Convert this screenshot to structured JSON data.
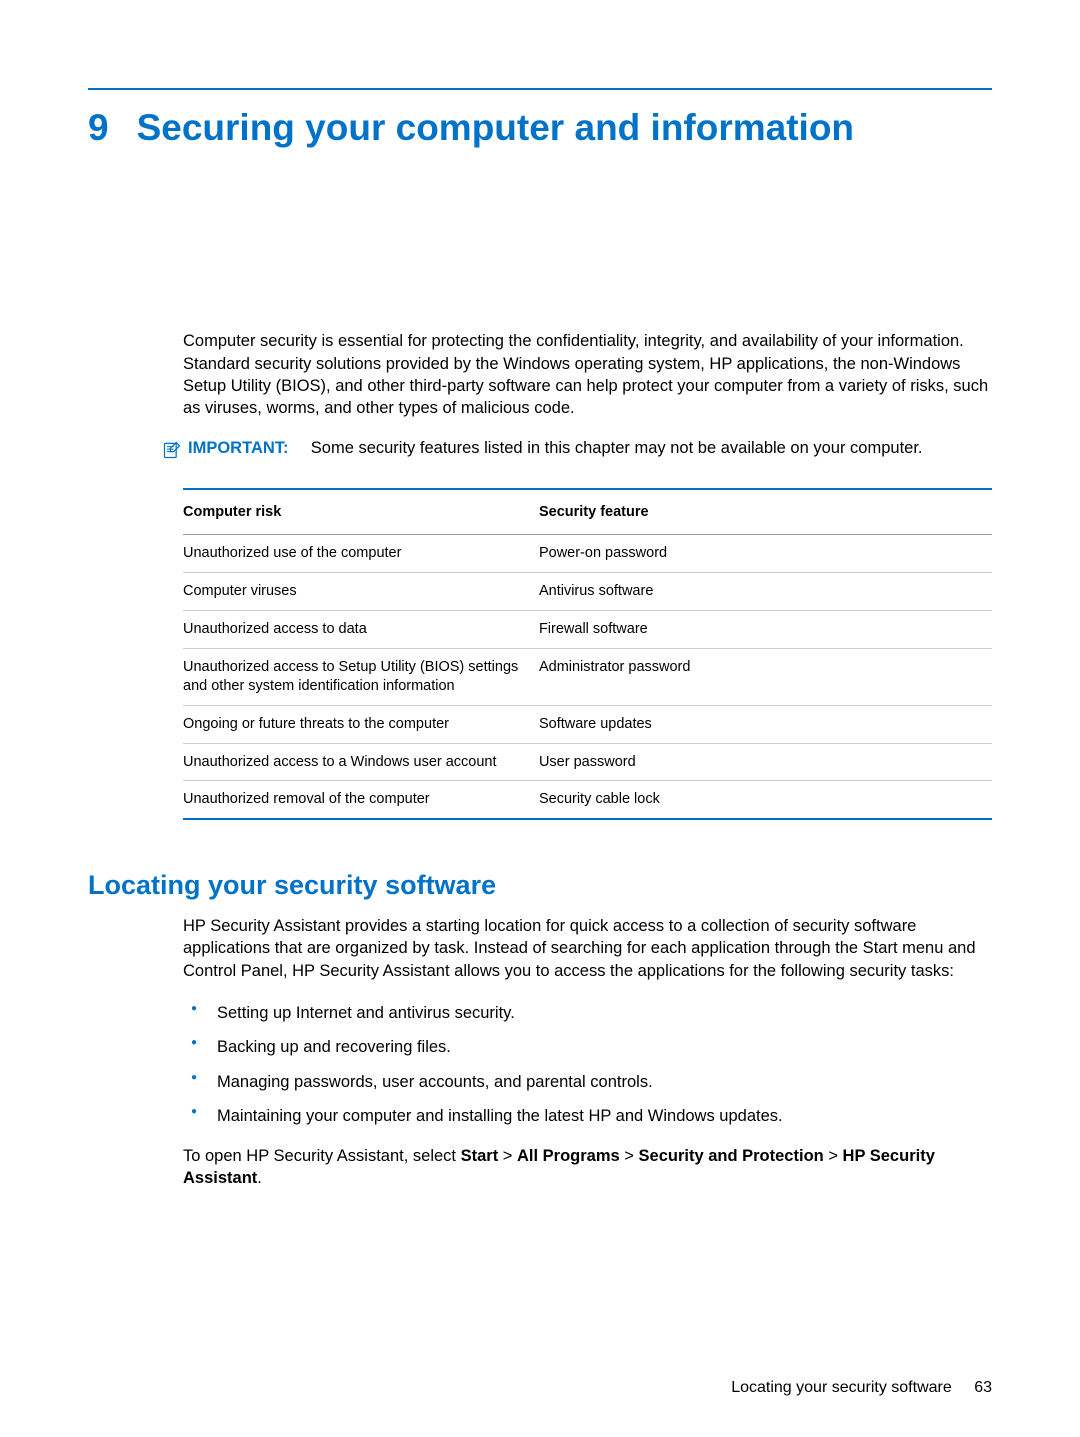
{
  "chapter": {
    "number": "9",
    "title": "Securing your computer and information"
  },
  "intro": "Computer security is essential for protecting the confidentiality, integrity, and availability of your information. Standard security solutions provided by the Windows operating system, HP applications, the non-Windows Setup Utility (BIOS), and other third-party software can help protect your computer from a variety of risks, such as viruses, worms, and other types of malicious code.",
  "important": {
    "label": "IMPORTANT:",
    "text": "Some security features listed in this chapter may not be available on your computer."
  },
  "table": {
    "headers": [
      "Computer risk",
      "Security feature"
    ],
    "rows": [
      [
        "Unauthorized use of the computer",
        "Power-on password"
      ],
      [
        "Computer viruses",
        "Antivirus software"
      ],
      [
        "Unauthorized access to data",
        "Firewall software"
      ],
      [
        "Unauthorized access to Setup Utility (BIOS) settings and other system identification information",
        "Administrator password"
      ],
      [
        "Ongoing or future threats to the computer",
        "Software updates"
      ],
      [
        "Unauthorized access to a Windows user account",
        "User password"
      ],
      [
        "Unauthorized removal of the computer",
        "Security cable lock"
      ]
    ]
  },
  "section": {
    "heading": "Locating your security software",
    "body": "HP Security Assistant provides a starting location for quick access to a collection of security software applications that are organized by task. Instead of searching for each application through the Start menu and Control Panel, HP Security Assistant allows you to access the applications for the following security tasks:",
    "bullets": [
      "Setting up Internet and antivirus security.",
      "Backing up and recovering files.",
      "Managing passwords, user accounts, and parental controls.",
      "Maintaining your computer and installing the latest HP and Windows updates."
    ],
    "closing_parts": [
      {
        "text": "To open HP Security Assistant, select ",
        "bold": false
      },
      {
        "text": "Start",
        "bold": true
      },
      {
        "text": " > ",
        "bold": false
      },
      {
        "text": "All Programs",
        "bold": true
      },
      {
        "text": " > ",
        "bold": false
      },
      {
        "text": "Security and Protection",
        "bold": true
      },
      {
        "text": " > ",
        "bold": false
      },
      {
        "text": "HP Security Assistant",
        "bold": true
      },
      {
        "text": ".",
        "bold": false
      }
    ]
  },
  "footer": {
    "text": "Locating your security software",
    "page": "63"
  }
}
